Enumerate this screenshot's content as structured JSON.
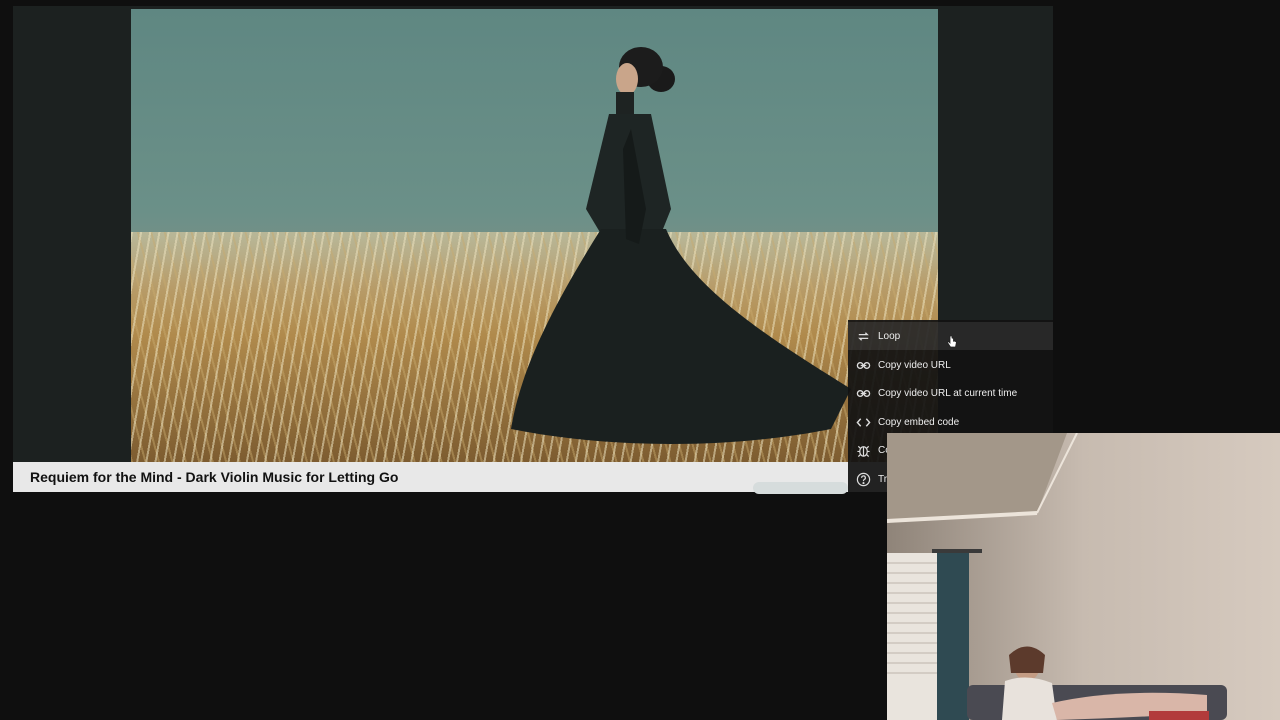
{
  "video": {
    "title": "Requiem for the Mind - Dark Violin Music for Letting Go"
  },
  "context_menu": {
    "items": [
      {
        "label": "Loop",
        "icon": "loop-icon"
      },
      {
        "label": "Copy video URL",
        "icon": "link-icon"
      },
      {
        "label": "Copy video URL at current time",
        "icon": "link-icon"
      },
      {
        "label": "Copy embed code",
        "icon": "embed-code-icon"
      },
      {
        "label": "Co",
        "icon": "bug-icon"
      },
      {
        "label": "Tr",
        "icon": "help-icon"
      }
    ]
  },
  "colors": {
    "page_background": "#0f0f0f",
    "title_bar": "#e8e8e8",
    "menu_background": "#121212"
  }
}
